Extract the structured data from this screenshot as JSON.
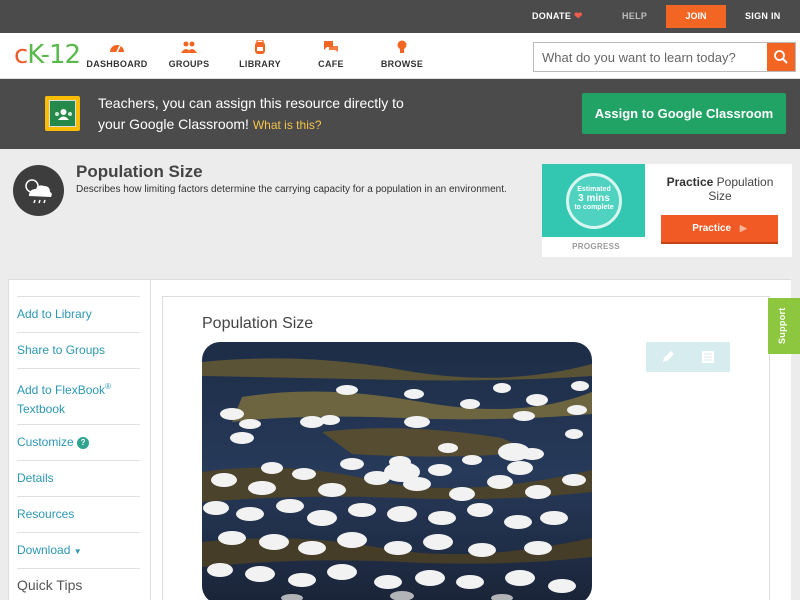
{
  "topbar": {
    "donate": "DONATE",
    "help": "HELP",
    "join": "JOIN",
    "signin": "SIGN IN"
  },
  "nav": {
    "logo_prefix": "c",
    "logo_mid": "K",
    "logo_suffix": "-12",
    "items": [
      {
        "label": "DASHBOARD",
        "icon": "dashboard-gauge-icon"
      },
      {
        "label": "GROUPS",
        "icon": "groups-people-icon"
      },
      {
        "label": "LIBRARY",
        "icon": "library-backpack-icon"
      },
      {
        "label": "CAFE",
        "icon": "cafe-chat-icon"
      },
      {
        "label": "BROWSE",
        "icon": "browse-lightbulb-icon"
      }
    ],
    "search_placeholder": "What do you want to learn today?"
  },
  "classroom": {
    "line1": "Teachers, you can assign this resource directly to",
    "line2": "your Google Classroom!",
    "what_link": "What is this?",
    "button": "Assign to Google Classroom"
  },
  "header": {
    "title": "Population Size",
    "description": "Describes how limiting factors determine the carrying capacity for a population in an environment."
  },
  "progress": {
    "estimated": "Estimated",
    "mins": "3 mins",
    "to_complete": "to complete",
    "label": "PROGRESS",
    "practice_bold": "Practice",
    "practice_rest": "Population Size",
    "practice_button": "Practice"
  },
  "sidebar": {
    "add_library": "Add to Library",
    "share_groups": "Share to Groups",
    "flexbook_line1": "Add to FlexBook",
    "flexbook_reg": "®",
    "flexbook_line2": "Textbook",
    "customize": "Customize",
    "customize_badge": "?",
    "details": "Details",
    "resources": "Resources",
    "download": "Download",
    "quick_tips": "Quick Tips"
  },
  "content": {
    "title": "Population Size",
    "image_subject": "flock of snow geese in a marsh"
  },
  "support": "Support",
  "colors": {
    "accent_orange": "#f26522",
    "google_green": "#21a366",
    "link_blue": "#2c97b3",
    "support_green": "#8dc63f"
  }
}
